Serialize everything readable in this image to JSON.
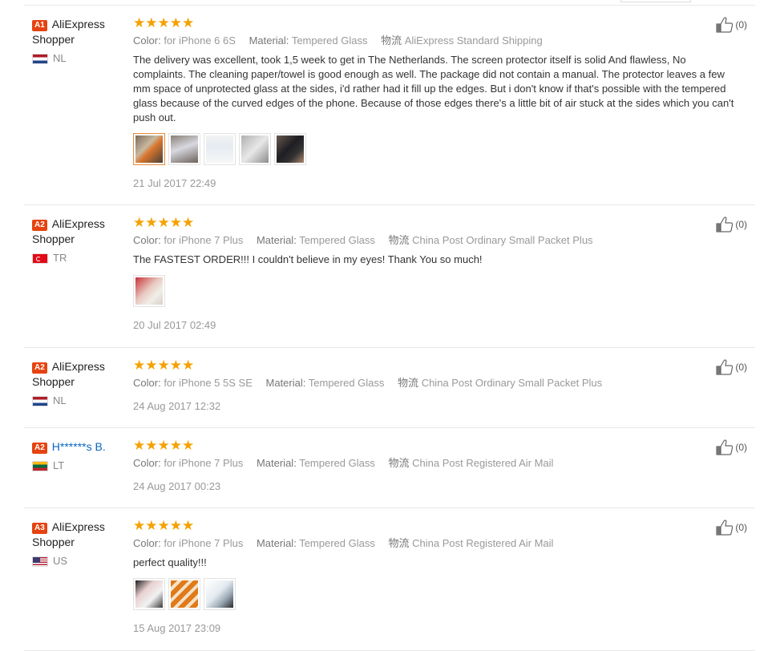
{
  "reviews": [
    {
      "badge": "A1",
      "name": "AliExpress Shopper",
      "country": "NL",
      "color_label": "Color:",
      "color_value": "for iPhone 6 6S",
      "material_label": "Material:",
      "material_value": "Tempered Glass",
      "shipping_label": "物流",
      "shipping_value": "AliExpress Standard Shipping",
      "text": "The delivery was excellent, took 1,5 week to get in The Netherlands. The screen protector itself is solid And flawless, No complaints. The cleaning paper/towel is good enough as well. The package did not contain a manual. The protector leaves a few mm space of unprotected glass at the sides, i'd rather had it fill up the edges. But i don't know if that's possible with the tempered glass because of the curved edges of the phone. Because of those edges there's a little bit of air stuck at the sides which you can't push out.",
      "date": "21 Jul 2017 22:49",
      "likes": "(0)",
      "stars": "★★★★★"
    },
    {
      "badge": "A2",
      "name": "AliExpress Shopper",
      "country": "TR",
      "color_label": "Color:",
      "color_value": "for iPhone 7 Plus",
      "material_label": "Material:",
      "material_value": "Tempered Glass",
      "shipping_label": "物流",
      "shipping_value": "China Post Ordinary Small Packet Plus",
      "text": "The FASTEST ORDER!!! I couldn't believe in my eyes! Thank You so much!",
      "date": "20 Jul 2017 02:49",
      "likes": "(0)",
      "stars": "★★★★★"
    },
    {
      "badge": "A2",
      "name": "AliExpress Shopper",
      "country": "NL",
      "color_label": "Color:",
      "color_value": "for iPhone 5 5S SE",
      "material_label": "Material:",
      "material_value": "Tempered Glass",
      "shipping_label": "物流",
      "shipping_value": "China Post Ordinary Small Packet Plus",
      "date": "24 Aug 2017 12:32",
      "likes": "(0)",
      "stars": "★★★★★"
    },
    {
      "badge": "A2",
      "name": "H******s B.",
      "country": "LT",
      "color_label": "Color:",
      "color_value": "for iPhone 7 Plus",
      "material_label": "Material:",
      "material_value": "Tempered Glass",
      "shipping_label": "物流",
      "shipping_value": "China Post Registered Air Mail",
      "date": "24 Aug 2017 00:23",
      "likes": "(0)",
      "stars": "★★★★★"
    },
    {
      "badge": "A3",
      "name": "AliExpress Shopper",
      "country": "US",
      "color_label": "Color:",
      "color_value": "for iPhone 7 Plus",
      "material_label": "Material:",
      "material_value": "Tempered Glass",
      "shipping_label": "物流",
      "shipping_value": "China Post Registered Air Mail",
      "text": "perfect quality!!!",
      "date": "15 Aug 2017 23:09",
      "likes": "(0)",
      "stars": "★★★★★"
    }
  ],
  "colors": {
    "badge": "#e64310",
    "star": "#f5a100",
    "masked_name": "#0b64c0",
    "selected_photo_border": "#e88c3a"
  }
}
